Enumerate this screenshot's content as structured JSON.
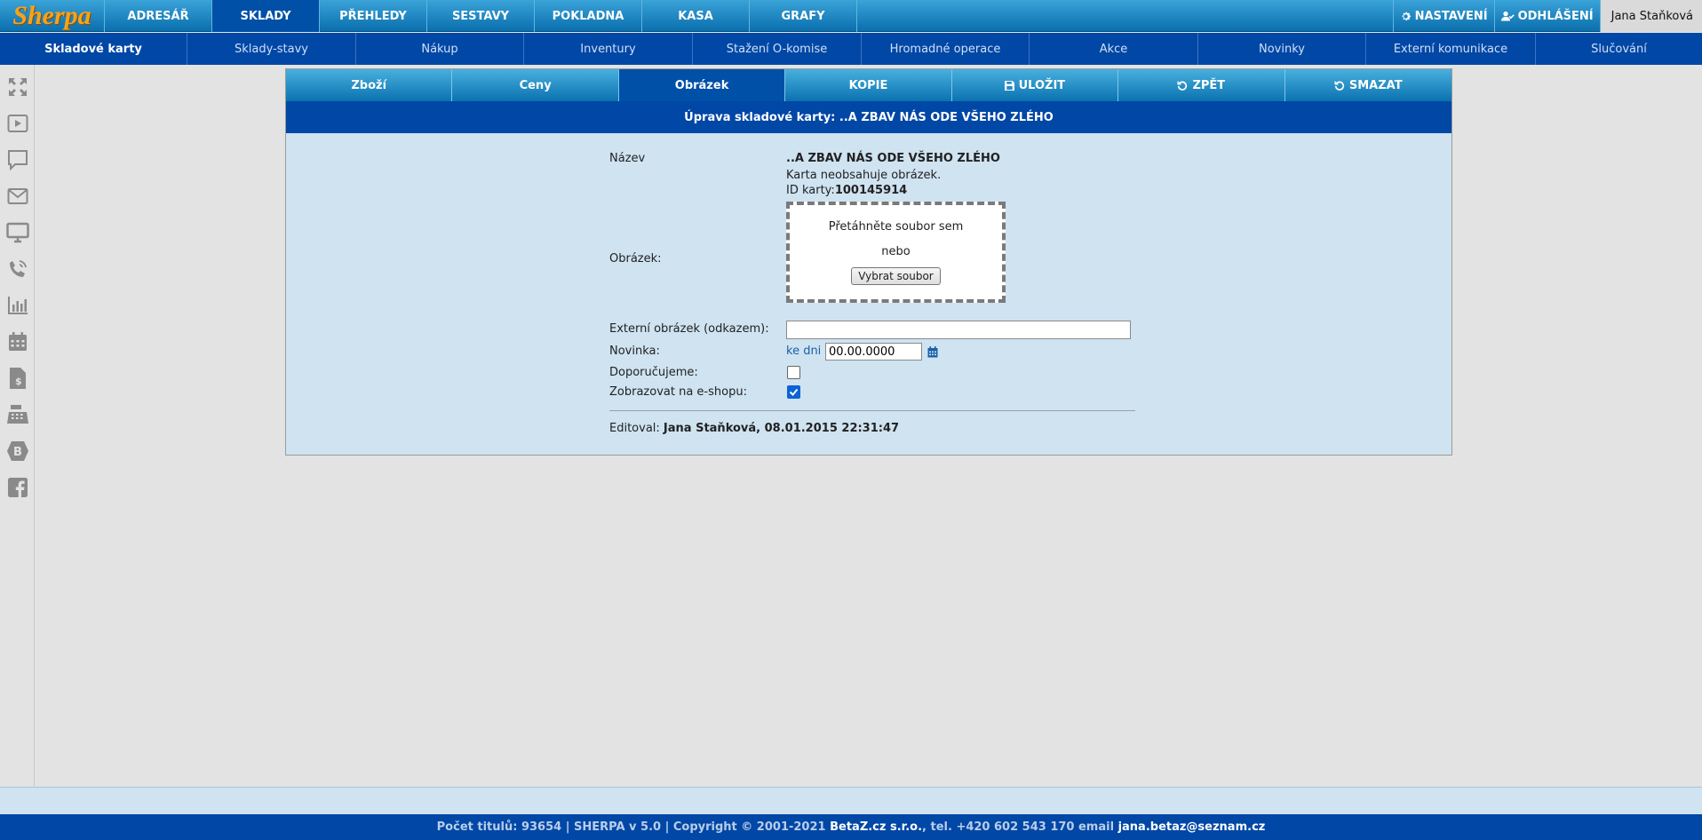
{
  "app": {
    "logo": "Sherpa"
  },
  "main_menu": [
    "ADRESÁŘ",
    "SKLADY",
    "PŘEHLEDY",
    "SESTAVY",
    "POKLADNA",
    "KASA",
    "GRAFY"
  ],
  "main_menu_active": "SKLADY",
  "top_right": {
    "settings": "NASTAVENÍ",
    "logout": "ODHLÁŠENÍ",
    "user": "Jana Staňková"
  },
  "sub_menu": [
    "Skladové karty",
    "Sklady-stavy",
    "Nákup",
    "Inventury",
    "Stažení O-komise",
    "Hromadné operace",
    "Akce",
    "Novinky",
    "Externí komunikace",
    "Slučování"
  ],
  "sub_menu_active": "Skladové karty",
  "sidebar_icons": [
    "expand-icon",
    "video-icon",
    "chat-icon",
    "mail-icon",
    "monitor-icon",
    "phone-icon",
    "bar-chart-icon",
    "calendar-icon",
    "invoice-icon",
    "cash-register-icon",
    "bootstrap-icon",
    "facebook-icon"
  ],
  "tabs": {
    "goods": "Zboží",
    "prices": "Ceny",
    "image": "Obrázek",
    "copy": "KOPIE",
    "save": "ULOŽIT",
    "back": "ZPĚT",
    "delete": "SMAZAT"
  },
  "title": "Úprava skladové karty: ..A ZBAV NÁS ODE VŠEHO ZLÉHO",
  "form": {
    "name_label": "Název",
    "name_value": "..A ZBAV NÁS ODE VŠEHO ZLÉHO",
    "no_image": "Karta neobsahuje obrázek.",
    "card_id_label": "ID karty:",
    "card_id": "100145914",
    "image_label": "Obrázek:",
    "drop_text": "Přetáhněte soubor sem",
    "or_text": "nebo",
    "choose_file": "Vybrat soubor",
    "external_label": "Externí obrázek (odkazem):",
    "external_value": "",
    "new_label": "Novinka:",
    "days_label": "ke dni",
    "date_value": "00.00.0000",
    "recommended_label": "Doporučujeme:",
    "recommended_checked": false,
    "eshop_label": "Zobrazovat na e-shopu:",
    "eshop_checked": true,
    "edited_label": "Editoval:",
    "edited_value": "Jana Staňková, 08.01.2015 22:31:47"
  },
  "footer": {
    "text": "Počet titulů: 93654 | SHERPA v 5.0 | Copyright © 2001-2021 ",
    "company": "BetaZ.cz s.r.o.",
    "phone": ", tel. +420 602 543 170 email ",
    "email": "jana.betaz@seznam.cz"
  },
  "colors": {
    "accent": "#0047a6",
    "light_panel": "#cfe3f1",
    "logo": "#f4a31e"
  }
}
